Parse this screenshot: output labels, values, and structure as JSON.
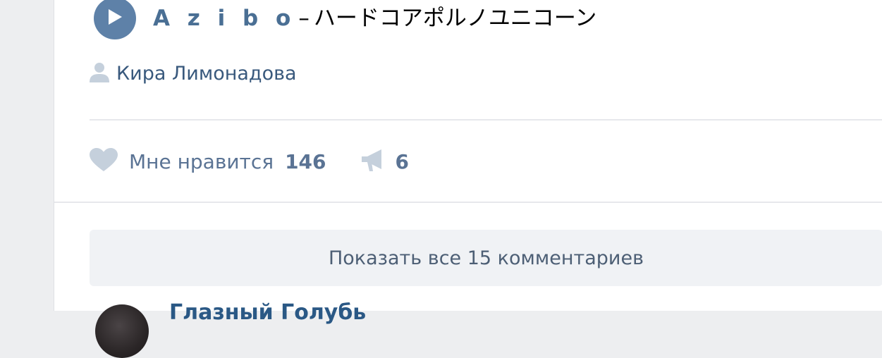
{
  "track": {
    "artist": "A z i b o",
    "separator": "–",
    "title": "ハードコアポルノユニコーン"
  },
  "author": {
    "name": "Кира Лимонадова"
  },
  "actions": {
    "like_label": "Мне нравится",
    "like_count": "146",
    "share_count": "6"
  },
  "comments": {
    "show_all_label": "Показать все 15 комментариев",
    "first_author": "Глазный Голубь"
  },
  "icons": {
    "play": "play-icon",
    "user": "user-icon",
    "like": "heart-icon",
    "share": "megaphone-icon"
  },
  "colors": {
    "accent": "#5e81a8",
    "link": "#39597d",
    "icon_muted": "#c5d0dc",
    "page_bg": "#edeef0"
  }
}
